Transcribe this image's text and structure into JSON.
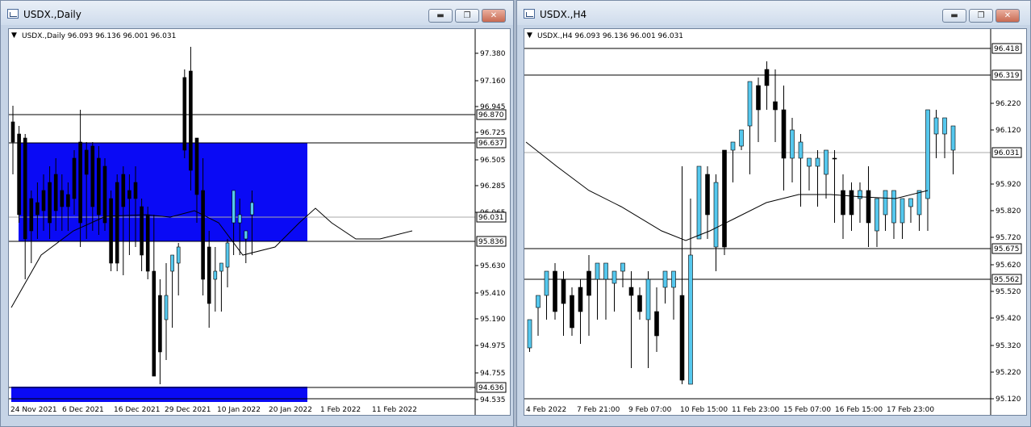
{
  "left_window": {
    "title": "USDX.,Daily",
    "buttons": {
      "minimize": "▬",
      "maximize": "❐",
      "close": "✕"
    },
    "chart_header": "USDX.,Daily  96.093 96.136 96.001 96.031",
    "price_labels": [
      "97.380",
      "97.160",
      "96.945",
      "96.725",
      "96.505",
      "96.285",
      "96.065",
      "95.630",
      "95.410",
      "95.190",
      "94.975",
      "94.755",
      "94.535"
    ],
    "level_labels": [
      "96.870",
      "96.637",
      "96.031",
      "95.836",
      "94.636"
    ],
    "date_labels": [
      "24 Nov 2021",
      "6 Dec 2021",
      "16 Dec 2021",
      "29 Dec 2021",
      "10 Jan 2022",
      "20 Jan 2022",
      "1 Feb 2022",
      "11 Feb 2022"
    ],
    "colors": {
      "bull": "#55c8ee",
      "bear": "#000000",
      "zone": "#0a0af5"
    }
  },
  "right_window": {
    "title": "USDX.,H4",
    "buttons": {
      "minimize": "▬",
      "maximize": "❐",
      "close": "✕"
    },
    "chart_header": "USDX.,H4  96.093 96.136 96.001 96.031",
    "price_labels": [
      "96.220",
      "96.120",
      "95.920",
      "95.820",
      "95.720",
      "95.620",
      "95.520",
      "95.420",
      "95.320",
      "95.220",
      "95.120"
    ],
    "level_labels": [
      "96.418",
      "96.319",
      "96.031",
      "95.675",
      "95.562"
    ],
    "date_labels": [
      "4 Feb 2022",
      "7 Feb 21:00",
      "9 Feb 07:00",
      "10 Feb 15:00",
      "11 Feb 23:00",
      "15 Feb 07:00",
      "16 Feb 15:00",
      "17 Feb 23:00"
    ],
    "colors": {
      "bull": "#55c8ee",
      "bear": "#000000"
    }
  }
}
